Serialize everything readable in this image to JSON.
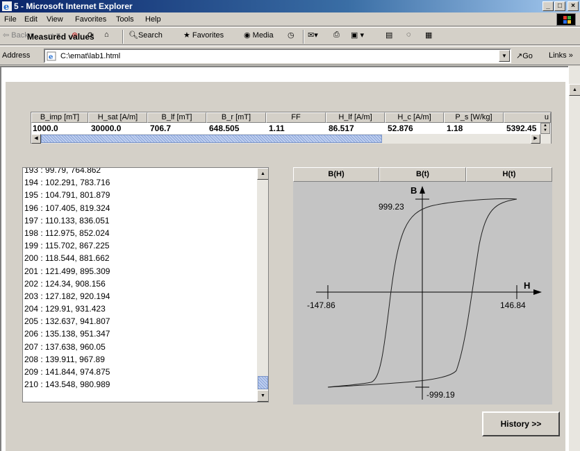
{
  "window": {
    "title": "5 - Microsoft Internet Explorer"
  },
  "menu": [
    "File",
    "Edit",
    "View",
    "Favorites",
    "Tools",
    "Help"
  ],
  "toolbar": {
    "back": "Back",
    "search": "Search",
    "favorites": "Favorites",
    "media": "Media"
  },
  "address": {
    "label": "Address",
    "url": "C:\\emat\\lab1.html",
    "go": "Go",
    "links": "Links »"
  },
  "measured": {
    "title": "Measured values",
    "headers": [
      "B_imp [mT]",
      "H_sat [A/m]",
      "B_lf [mT]",
      "B_r [mT]",
      "FF",
      "H_lf [A/m]",
      "H_c [A/m]",
      "P_s [W/kg]",
      "u"
    ],
    "values": [
      "1000.0",
      "30000.0",
      "706.7",
      "648.505",
      "1.11",
      "86.517",
      "52.876",
      "1.18",
      "5392.45"
    ],
    "scroll_position": 0.82
  },
  "list": {
    "items": [
      "193 : 99.79, 764.862",
      "194 : 102.291, 783.716",
      "195 : 104.791, 801.879",
      "196 : 107.405, 819.324",
      "197 : 110.133, 836.051",
      "198 : 112.975, 852.024",
      "199 : 115.702, 867.225",
      "200 : 118.544, 881.662",
      "201 : 121.499, 895.309",
      "202 : 124.34, 908.156",
      "203 : 127.182, 920.194",
      "204 : 129.91, 931.423",
      "205 : 132.637, 941.807",
      "206 : 135.138, 951.347",
      "207 : 137.638, 960.05",
      "208 : 139.911, 967.89",
      "209 : 141.844, 974.875",
      "210 : 143.548, 980.989"
    ]
  },
  "plot": {
    "tabs": [
      "B(H)",
      "B(t)",
      "H(t)"
    ],
    "active_tab": "B(H)",
    "axis_b": "B",
    "axis_h": "H",
    "b_max_label": "999.23",
    "b_min_label": "-999.19",
    "h_min_label": "-147.86",
    "h_max_label": "146.84"
  },
  "history_button": "History >>",
  "colors": {
    "title_start": "#0a246a",
    "plot_bg": "#c4c4c4",
    "face": "#d4d0c8"
  }
}
